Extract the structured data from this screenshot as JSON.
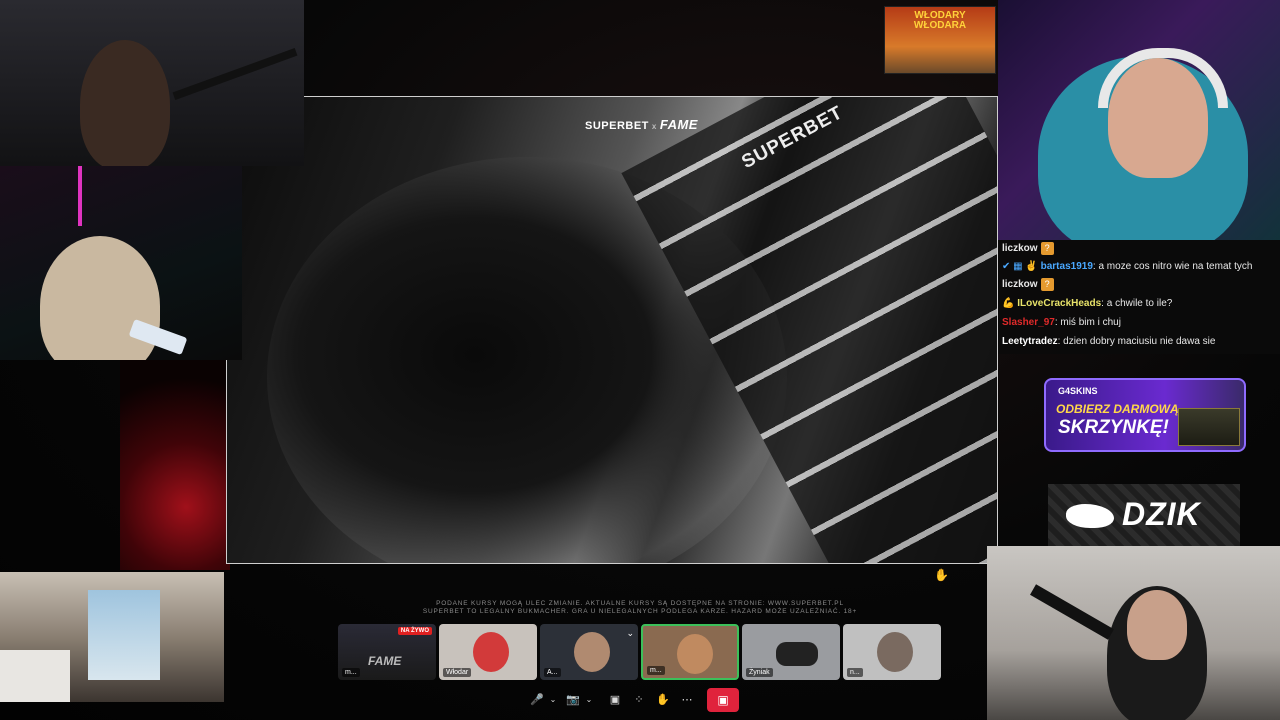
{
  "video": {
    "brand_left": "SUPERBET",
    "brand_x": "x",
    "brand_right": "FAME",
    "ring_banner": "SUPERBET"
  },
  "poster": {
    "line1": "WŁODARY",
    "line2": "WŁODARA"
  },
  "chat": {
    "messages": [
      {
        "user": "liczkow",
        "text": "",
        "emote": "?"
      },
      {
        "user": "bartas1919",
        "text": ": a moze cos nitro wie na temat tych",
        "color": "#4aa8ff",
        "prefix": "✔ ▦ ✌"
      },
      {
        "user": "liczkow",
        "text": "",
        "emote": "?"
      },
      {
        "user": "ILoveCrackHeads",
        "text": ": a chwile to ile?",
        "color": "#e8e36a",
        "prefix": "💪"
      },
      {
        "user": "Slasher_97",
        "text": ": miś bim i chuj",
        "color": "#e02a2a"
      },
      {
        "user": "Leetytradez",
        "text": ": dzien dobry maciusiu nie dawa sie",
        "color": "#ffffff"
      }
    ]
  },
  "ads": {
    "skins_logo": "G4SKINS",
    "skins_line1": "ODBIERZ DARMOWĄ",
    "skins_line2": "SKRZYNKĘ!",
    "dzik": "DZIK"
  },
  "disclaimer": {
    "line1": "PODANE KURSY MOGĄ ULEC ZMIANIE. AKTUALNE KURSY SĄ DOSTĘPNE NA STRONIE: WWW.SUPERBET.PL",
    "line2": "SUPERBET TO LEGALNY BUKMACHER. GRA U NIELEGALNYCH PODLEGA KARZE. HAZARD MOŻE UZALEŻNIAĆ. 18+"
  },
  "participants": [
    {
      "label": "m...",
      "badge": "NA ŻYWO",
      "screen_text": "FAME"
    },
    {
      "label": "Włodar"
    },
    {
      "label": "A..."
    },
    {
      "label": "m..."
    },
    {
      "label": "Żyniak"
    },
    {
      "label": "n..."
    }
  ],
  "controls": {
    "mic": "🎤",
    "cam": "📷",
    "share": "▣",
    "grid": "⁘",
    "hand": "✋",
    "more": "⋯",
    "leave": "▣"
  },
  "colors": {
    "leave": "#e0233c",
    "live_badge": "#e02020",
    "ad_purple": "#6a2ad0"
  }
}
